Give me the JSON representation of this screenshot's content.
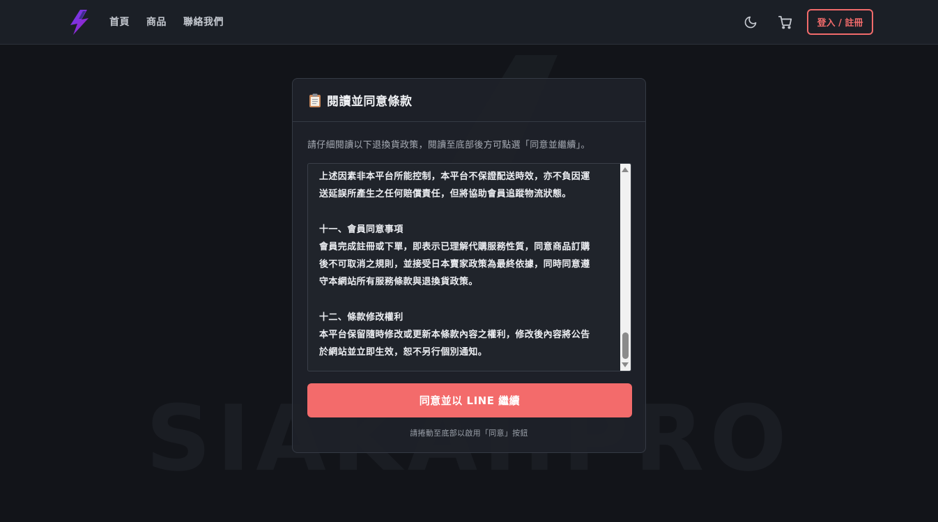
{
  "header": {
    "logo_icon": "lightning-bolt-logo",
    "nav": [
      {
        "label": "首頁"
      },
      {
        "label": "商品"
      },
      {
        "label": "聯絡我們"
      }
    ],
    "theme_toggle_icon": "moon-icon",
    "cart_icon": "cart-icon",
    "login_label": "登入 / 註冊",
    "accent_color": "#f16b6b"
  },
  "watermark": {
    "text": "SIAKAI.PRO"
  },
  "card": {
    "title": "閱讀並同意條款",
    "title_icon": "clipboard-icon",
    "instruction": "請仔細閱讀以下退換貨政策，閱讀至底部後方可點選「同意並繼續」。",
    "terms_lines": [
      "上述因素非本平台所能控制，本平台不保證配送時效，亦不負因運",
      "送延誤所產生之任何賠償責任，但將協助會員追蹤物流狀態。",
      "",
      "十一、會員同意事項",
      "會員完成註冊或下單，即表示已理解代購服務性質，同意商品訂購",
      "後不可取消之規則，並接受日本賣家政策為最終依據，同時同意遵",
      "守本網站所有服務條款與退換貨政策。",
      "",
      "十二、條款修改權利",
      "本平台保留隨時修改或更新本條款內容之權利，修改後內容將公告",
      "於網站並立即生效，恕不另行個別通知。"
    ],
    "agree_button_label": "同意並以 LINE 繼續",
    "agree_button_color": "#f36b6b",
    "hint": "請捲動至底部以啟用「同意」按鈕"
  }
}
